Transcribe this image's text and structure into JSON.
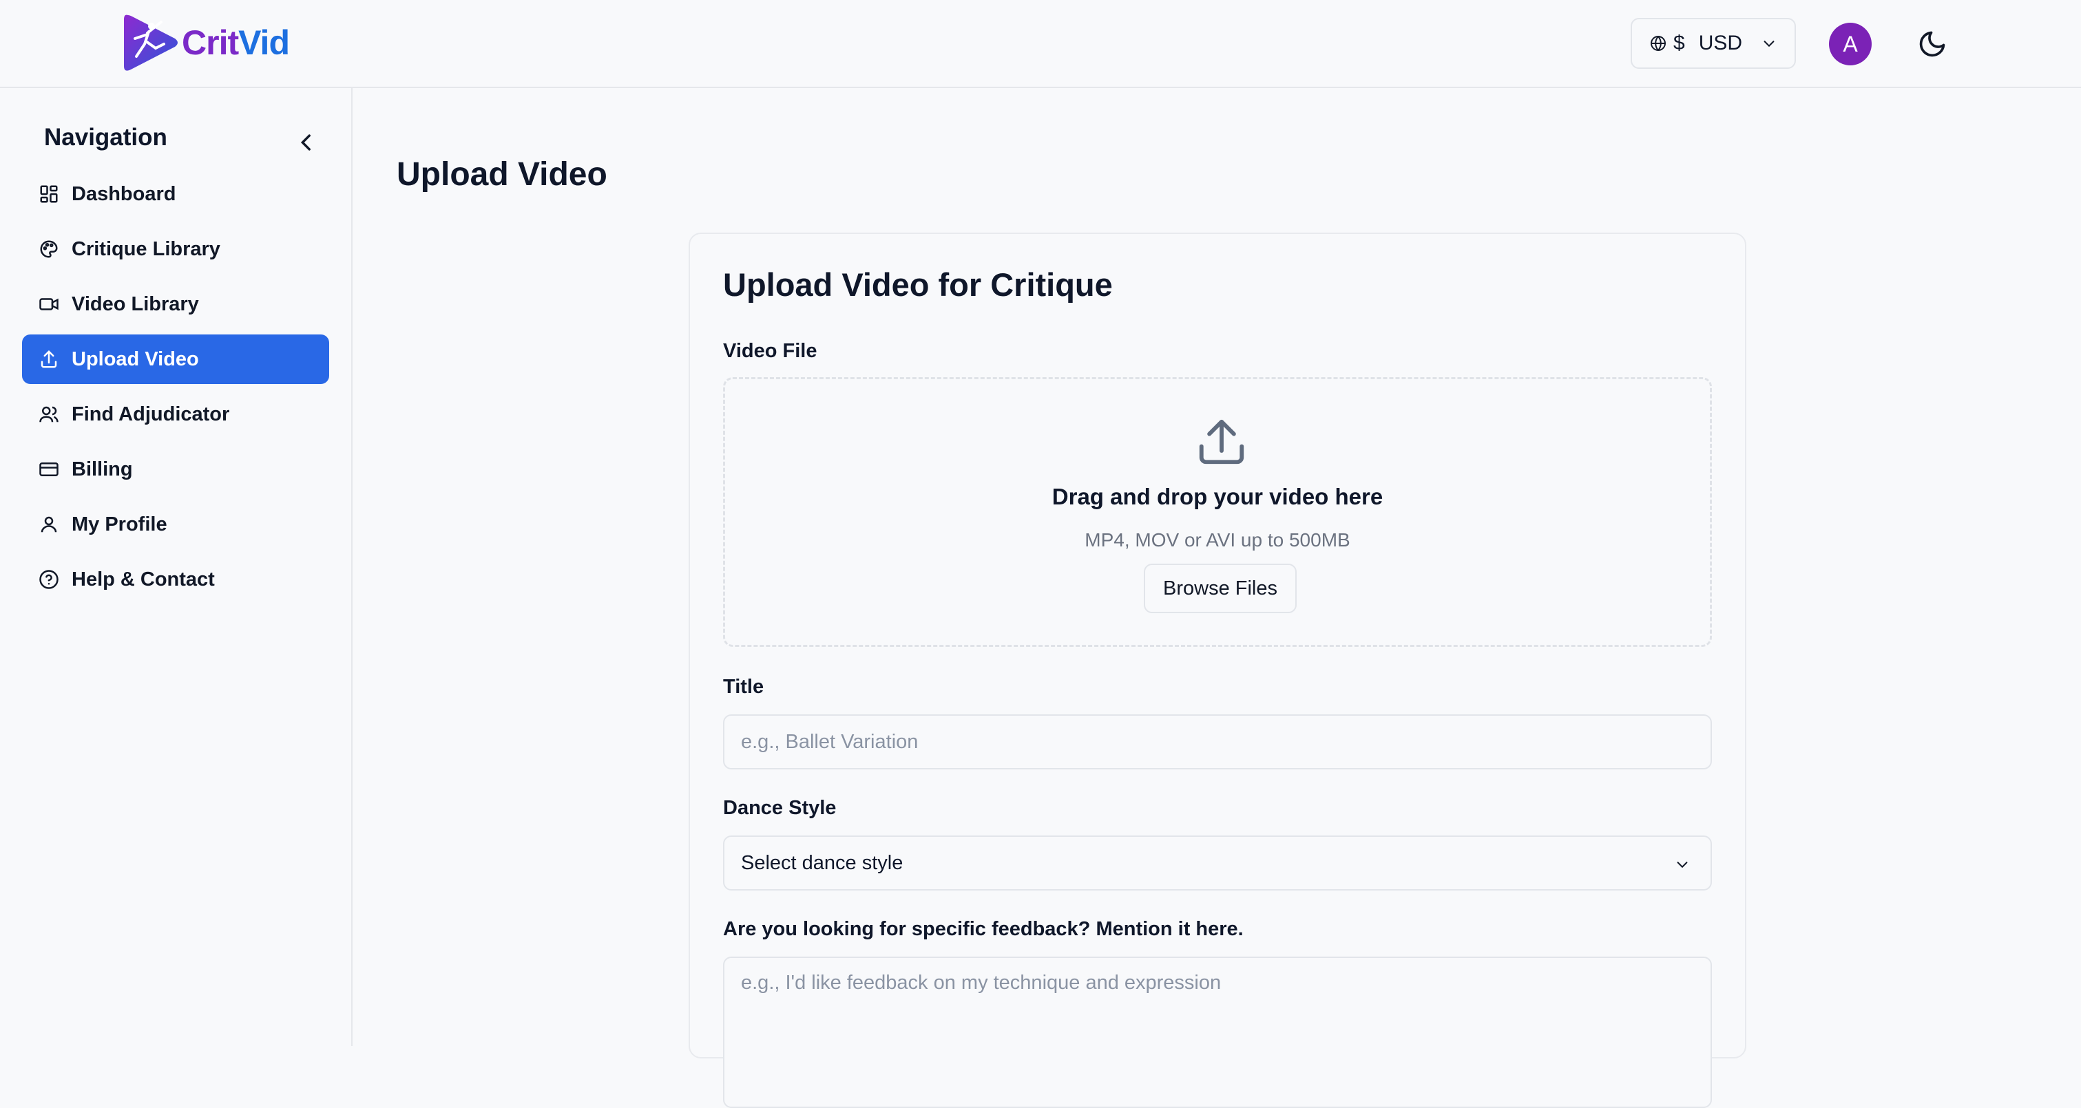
{
  "brand": {
    "name_part1": "Crit",
    "name_part2": "Vid"
  },
  "header": {
    "currency_symbol": "$",
    "currency_code": "USD",
    "avatar_initial": "A"
  },
  "sidebar": {
    "title": "Navigation",
    "items": [
      {
        "label": "Dashboard",
        "icon": "dashboard-icon",
        "active": false
      },
      {
        "label": "Critique Library",
        "icon": "palette-icon",
        "active": false
      },
      {
        "label": "Video Library",
        "icon": "video-icon",
        "active": false
      },
      {
        "label": "Upload Video",
        "icon": "upload-icon",
        "active": true
      },
      {
        "label": "Find Adjudicator",
        "icon": "users-icon",
        "active": false
      },
      {
        "label": "Billing",
        "icon": "credit-card-icon",
        "active": false
      },
      {
        "label": "My Profile",
        "icon": "user-icon",
        "active": false
      },
      {
        "label": "Help & Contact",
        "icon": "help-circle-icon",
        "active": false
      }
    ]
  },
  "main": {
    "page_title": "Upload Video",
    "card_title": "Upload Video for Critique",
    "video_file": {
      "label": "Video File",
      "drop_title": "Drag and drop your video here",
      "drop_subtitle": "MP4, MOV or AVI up to 500MB",
      "browse_label": "Browse Files"
    },
    "title_field": {
      "label": "Title",
      "value": "",
      "placeholder": "e.g., Ballet Variation"
    },
    "dance_style": {
      "label": "Dance Style",
      "selected": "Select dance style"
    },
    "feedback": {
      "label": "Are you looking for specific feedback? Mention it here.",
      "value": "",
      "placeholder": "e.g., I'd like feedback on my technique and expression"
    }
  },
  "colors": {
    "accent": "#2968e6",
    "brand_purple": "#7b2ac8",
    "brand_blue": "#1d6fe0",
    "avatar": "#7b22b6"
  }
}
